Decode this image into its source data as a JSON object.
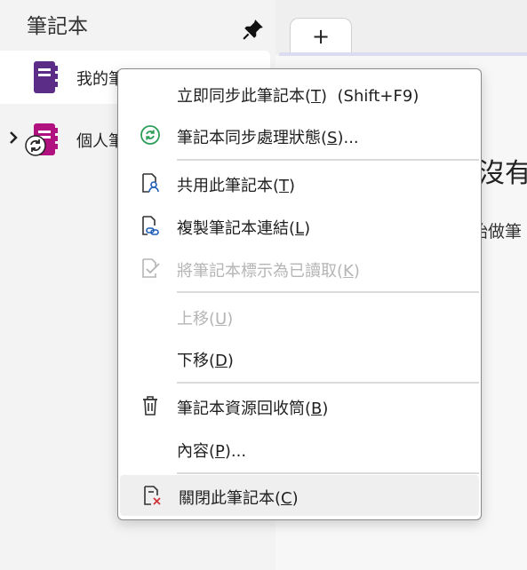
{
  "sidebar": {
    "title": "筆記本",
    "pin_icon": "pin-icon",
    "notebooks": [
      {
        "name": "我的筆",
        "color": "#5b2d86",
        "selected": true
      },
      {
        "name": "個人筆",
        "color": "#b0117f",
        "selected": false
      }
    ]
  },
  "content": {
    "add_tab_label": "+",
    "bg_title": "沒有",
    "bg_sub": "始做筆"
  },
  "menu": {
    "items": [
      {
        "label": "立即同步此筆記本(T)  (Shift+F9)",
        "icon": "",
        "disabled": false
      },
      {
        "label": "筆記本同步處理狀態(S)...",
        "icon": "sync-status-icon",
        "disabled": false
      },
      {
        "label": "共用此筆記本(T)",
        "icon": "share-notebook-icon",
        "disabled": false
      },
      {
        "label": "複製筆記本連結(L)",
        "icon": "copy-link-icon",
        "disabled": false
      },
      {
        "label": "將筆記本標示為已讀取(K)",
        "icon": "mark-read-icon",
        "disabled": true
      },
      {
        "label": "上移(U)",
        "icon": "",
        "disabled": true
      },
      {
        "label": "下移(D)",
        "icon": "",
        "disabled": false
      },
      {
        "label": "筆記本資源回收筒(B)",
        "icon": "recycle-bin-icon",
        "disabled": false
      },
      {
        "label": "內容(P)...",
        "icon": "",
        "disabled": false
      },
      {
        "label": "關閉此筆記本(C)",
        "icon": "close-notebook-icon",
        "disabled": false
      }
    ]
  },
  "colors": {
    "accent_green": "#2e9e5b",
    "accent_blue": "#1f5fb8",
    "close_red": "#d13438"
  }
}
